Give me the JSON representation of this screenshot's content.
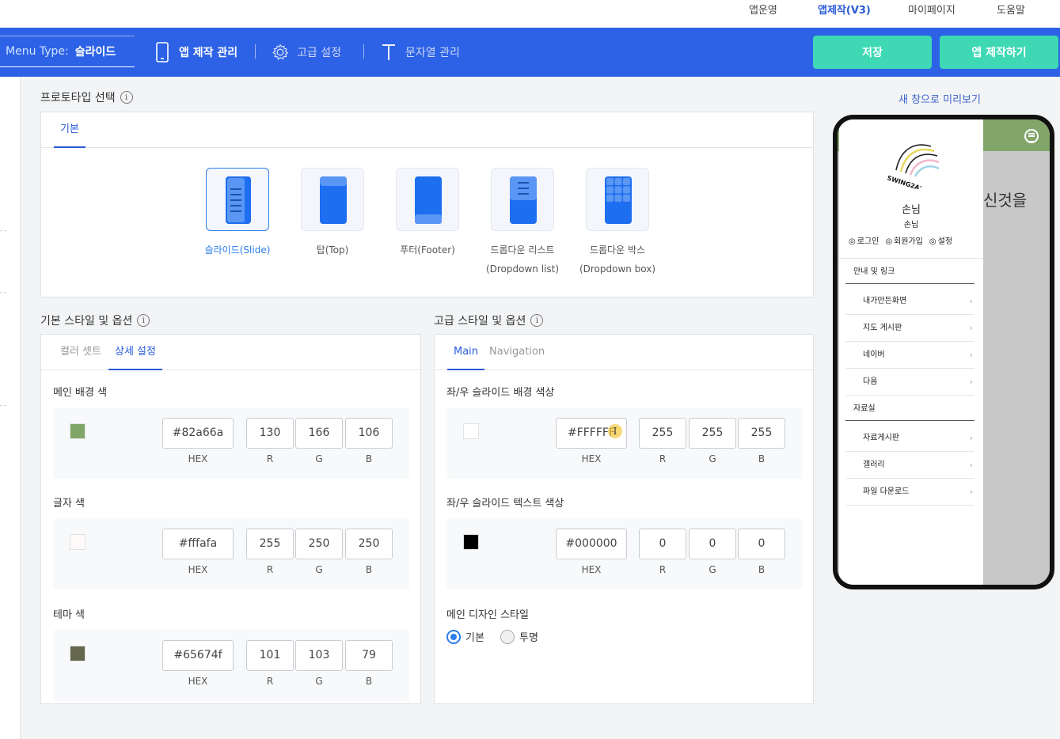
{
  "topnav": {
    "items": [
      "앱운영",
      "앱제작(V3)",
      "마이페이지",
      "도움말"
    ]
  },
  "bar": {
    "menu_type_label": "Menu Type:",
    "menu_type_value": "슬라이드",
    "app_manage": "앱 제작 관리",
    "advanced": "고급 설정",
    "strings": "문자열 관리",
    "save": "저장",
    "build": "앱 제작하기"
  },
  "prototype": {
    "title": "프로토타입 선택",
    "tab": "기본",
    "options": [
      {
        "label": "슬라이드(Slide)",
        "label2": ""
      },
      {
        "label": "탑(Top)",
        "label2": ""
      },
      {
        "label": "푸터(Footer)",
        "label2": ""
      },
      {
        "label": "드롭다운 리스트",
        "label2": "(Dropdown list)"
      },
      {
        "label": "드롭다운 박스",
        "label2": "(Dropdown box)"
      }
    ],
    "selected": 0
  },
  "basic": {
    "title": "기본 스타일 및 옵션",
    "tabs": [
      "컬러 셋트",
      "상세 설정"
    ],
    "fields": [
      {
        "label": "메인 배경 색",
        "hex": "#82a66a",
        "r": "130",
        "g": "166",
        "b": "106",
        "color": "#82a66a"
      },
      {
        "label": "글자 색",
        "hex": "#fffafa",
        "r": "255",
        "g": "250",
        "b": "250",
        "color": "#fffafa"
      },
      {
        "label": "테마 색",
        "hex": "#65674f",
        "r": "101",
        "g": "103",
        "b": "79",
        "color": "#65674f"
      }
    ]
  },
  "advanced": {
    "title": "고급 스타일 및 옵션",
    "tabs": [
      "Main",
      "Navigation"
    ],
    "fields": [
      {
        "label": "좌/우 슬라이드 배경 색상",
        "hex": "#FFFFFF",
        "r": "255",
        "g": "255",
        "b": "255",
        "color": "#ffffff"
      },
      {
        "label": "좌/우 슬라이드 텍스트 색상",
        "hex": "#000000",
        "r": "0",
        "g": "0",
        "b": "0",
        "color": "#000000"
      }
    ],
    "design_label": "메인 디자인 스타일",
    "radio": [
      "기본",
      "투명"
    ]
  },
  "sublabels": {
    "hex": "HEX",
    "r": "R",
    "g": "G",
    "b": "B"
  },
  "preview": {
    "link": "새 창으로 미리보기",
    "logo_text": "SWING2A'",
    "user_name": "손님",
    "user_sub": "손님",
    "links": [
      "로그인",
      "회원가입",
      "설정"
    ],
    "behind_text": "신것을",
    "groups": [
      {
        "title": "안내 및 링크",
        "items": [
          "내가만든화면",
          "지도 게시판",
          "네이버",
          "다음"
        ]
      },
      {
        "title": "자료실",
        "items": [
          "자료게시판",
          "갤러리",
          "파일 다운로드"
        ]
      }
    ]
  }
}
